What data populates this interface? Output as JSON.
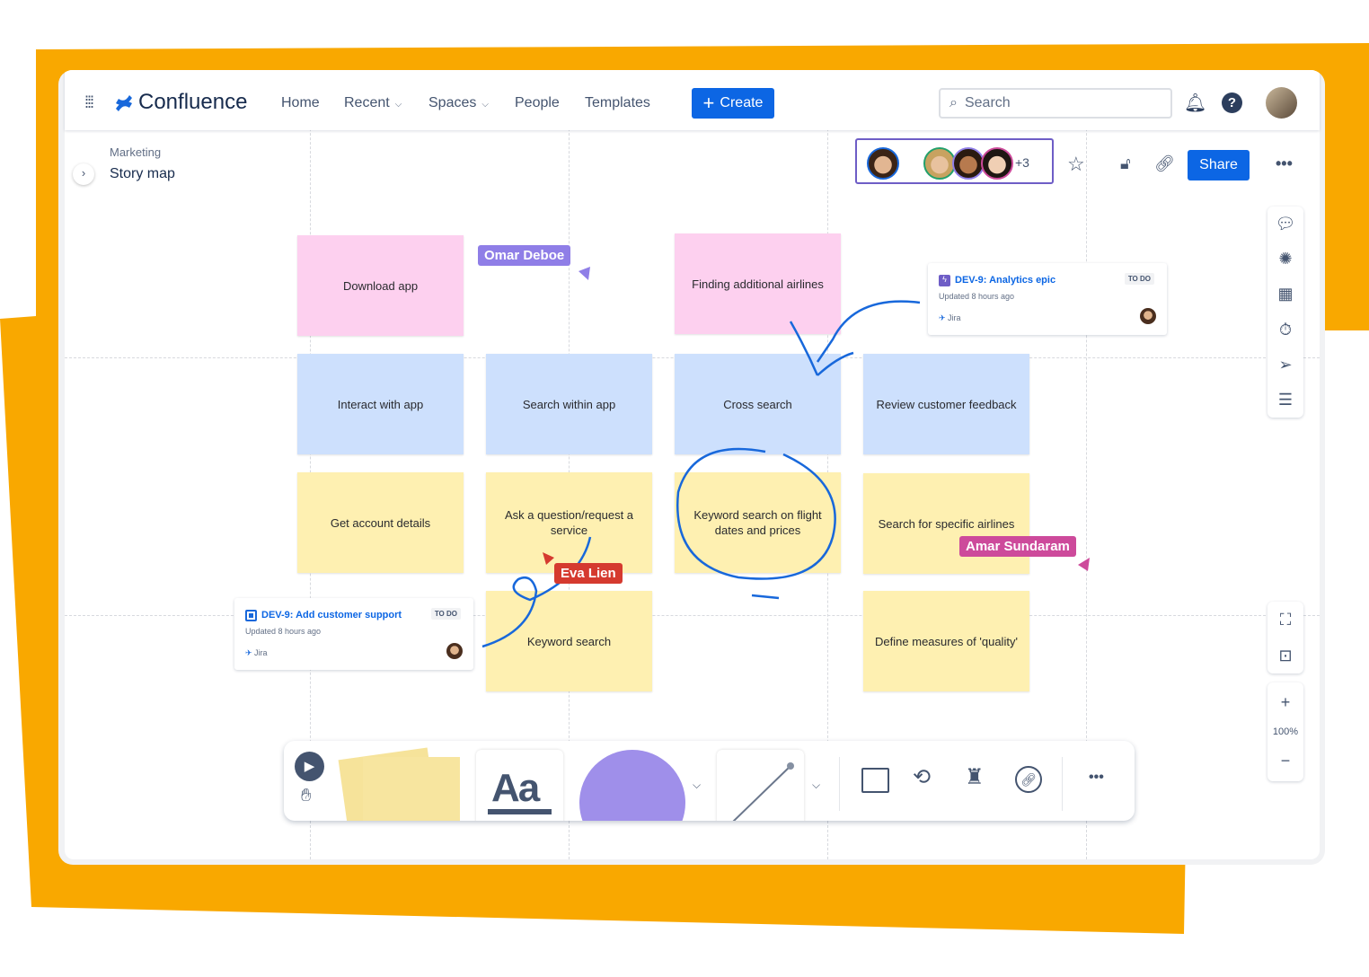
{
  "colors": {
    "backdrop": "#f9a800",
    "brand": "#0c66e4",
    "sticky_pink": "#fdd0ef",
    "sticky_blue": "#cde0fd",
    "sticky_yellow": "#fef0b1"
  },
  "header": {
    "app_name": "Confluence",
    "nav": [
      "Home",
      "Recent",
      "Spaces",
      "People",
      "Templates"
    ],
    "create_label": "Create",
    "search_placeholder": "Search"
  },
  "breadcrumb": {
    "space": "Marketing",
    "page": "Story map"
  },
  "collab": {
    "more_count": "+3",
    "share_label": "Share"
  },
  "stickies": [
    {
      "text": "Download app",
      "color": "pink"
    },
    {
      "text": "Finding additional airlines",
      "color": "pink"
    },
    {
      "text": "Interact with app",
      "color": "blue"
    },
    {
      "text": "Search within app",
      "color": "blue"
    },
    {
      "text": "Cross search",
      "color": "blue"
    },
    {
      "text": "Review customer feedback",
      "color": "blue"
    },
    {
      "text": "Get account details",
      "color": "yellow"
    },
    {
      "text": "Ask a question/request a service",
      "color": "yellow"
    },
    {
      "text": "Keyword search on flight dates and prices",
      "color": "yellow"
    },
    {
      "text": "Search for specific airlines",
      "color": "yellow"
    },
    {
      "text": "Keyword search",
      "color": "yellow"
    },
    {
      "text": "Define measures of 'quality'",
      "color": "yellow"
    }
  ],
  "cursors": [
    {
      "name": "Omar Deboe",
      "color": "#8f7ee7"
    },
    {
      "name": "Eva Lien",
      "color": "#d53a2f"
    },
    {
      "name": "Amar Sundaram",
      "color": "#cd4a9b"
    }
  ],
  "jira_cards": [
    {
      "title": "DEV-9: Analytics epic",
      "status": "TO DO",
      "updated": "Updated 8 hours ago",
      "source": "Jira",
      "icon": "epic-icon"
    },
    {
      "title": "DEV-9: Add customer support",
      "status": "TO DO",
      "updated": "Updated 8 hours ago",
      "source": "Jira",
      "icon": "task-icon"
    }
  ],
  "zoom": {
    "level": "100%"
  }
}
